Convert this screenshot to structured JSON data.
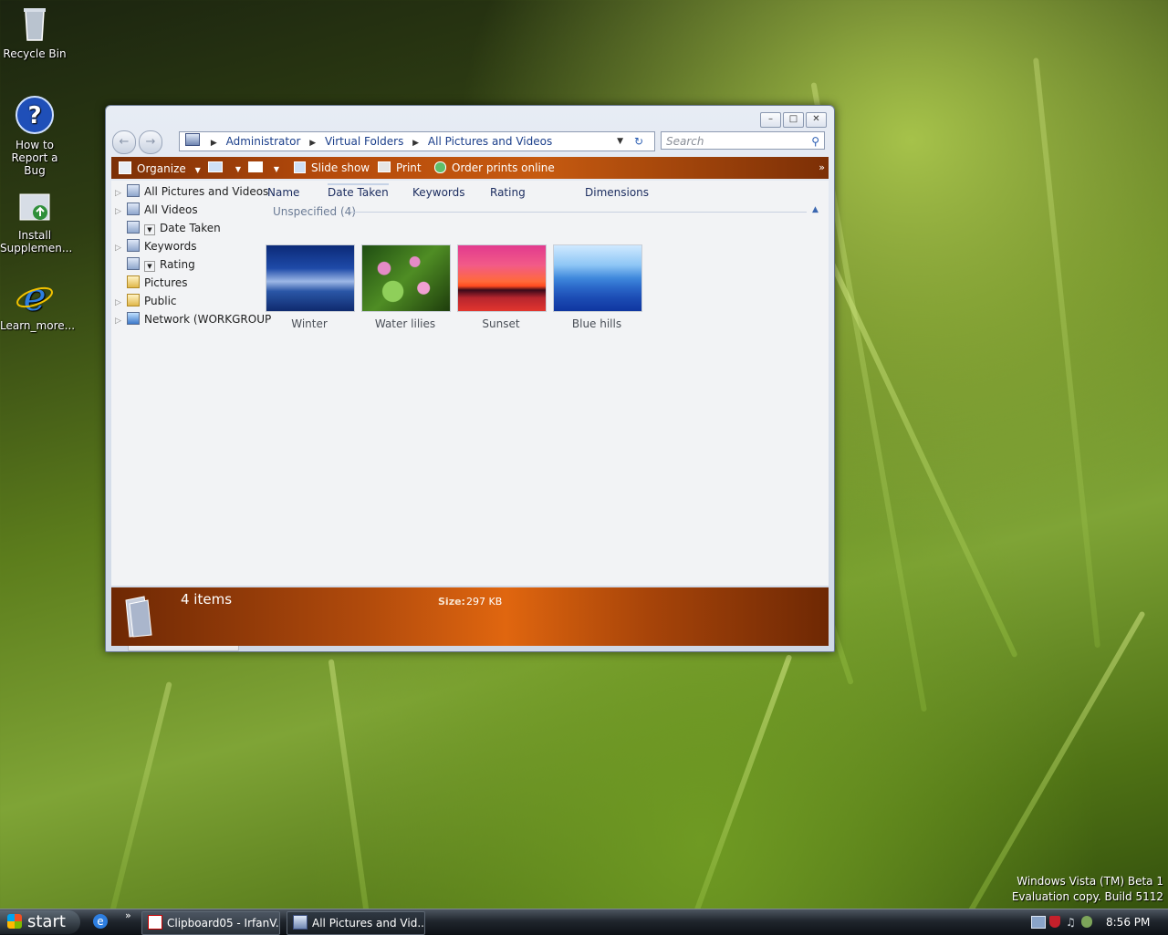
{
  "desktop": {
    "icons": [
      {
        "label": "Recycle Bin"
      },
      {
        "label": "How to\nReport a Bug"
      },
      {
        "label": "Install\nSupplemen..."
      },
      {
        "label": "Learn_more..."
      }
    ],
    "watermark_line1": "Windows Vista (TM) Beta 1",
    "watermark_line2": "Evaluation copy. Build 5112"
  },
  "window": {
    "controls": {
      "minimize": "–",
      "maximize": "□",
      "close": "✕"
    },
    "breadcrumb": [
      "Administrator",
      "Virtual Folders",
      "All Pictures and Videos"
    ],
    "search_placeholder": "Search",
    "toolbar": {
      "organize": "Organize",
      "slideshow": "Slide show",
      "print": "Print",
      "order_prints": "Order prints online",
      "more": "»"
    },
    "tree": [
      {
        "label": "All Pictures and Videos"
      },
      {
        "label": "All Videos"
      },
      {
        "label": "Date Taken"
      },
      {
        "label": "Keywords"
      },
      {
        "label": "Rating"
      },
      {
        "label": "Pictures"
      },
      {
        "label": "Public"
      },
      {
        "label": "Network (WORKGROUP"
      }
    ],
    "columns": [
      "Name",
      "Date Taken",
      "Keywords",
      "Rating",
      "Dimensions"
    ],
    "group_label": "Unspecified (4)",
    "thumbnails": [
      {
        "caption": "Winter"
      },
      {
        "caption": "Water lilies"
      },
      {
        "caption": "Sunset"
      },
      {
        "caption": "Blue hills"
      }
    ],
    "status": {
      "items": "4 items",
      "size_label": "Size:",
      "size_value": "297 KB"
    }
  },
  "taskbar": {
    "start_label": "start",
    "chevron": "»",
    "tasks": [
      {
        "label": "Clipboard05 - IrfanV..."
      },
      {
        "label": "All Pictures and Vid..."
      }
    ],
    "clock": "8:56 PM"
  }
}
